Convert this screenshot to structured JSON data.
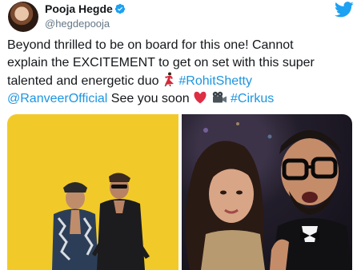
{
  "header": {
    "display_name": "Pooja Hegde",
    "handle": "@hegdepooja"
  },
  "tweet": {
    "line1": "Beyond thrilled to be on board for this one! Cannot",
    "line2": "explain the EXCITEMENT to get on set with this super",
    "line3_text": "talented and energetic duo ",
    "line3_hashtag": "#RohitShetty",
    "line4_mention": "@RanveerOfficial",
    "line4_text": " See you soon ",
    "line4_hashtag": "#Cirkus"
  },
  "icons": {
    "verified": "verified-badge-icon",
    "logo": "twitter-bird-icon",
    "dancer": "dancer-emoji",
    "heart": "red-heart-emoji",
    "camera": "movie-camera-emoji"
  },
  "colors": {
    "link": "#1b95e0",
    "twitter_blue": "#1da1f2",
    "photo_left_bg": "#f1ca2a"
  }
}
